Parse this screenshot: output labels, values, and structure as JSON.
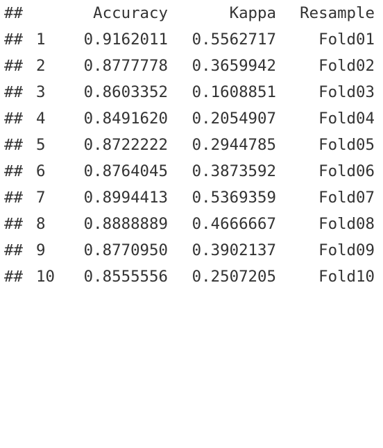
{
  "prompt": "##",
  "header": {
    "accuracy": "Accuracy",
    "kappa": "Kappa",
    "resample": "Resample"
  },
  "rows": [
    {
      "idx": "1",
      "accuracy": "0.9162011",
      "kappa": "0.5562717",
      "resample": "Fold01"
    },
    {
      "idx": "2",
      "accuracy": "0.8777778",
      "kappa": "0.3659942",
      "resample": "Fold02"
    },
    {
      "idx": "3",
      "accuracy": "0.8603352",
      "kappa": "0.1608851",
      "resample": "Fold03"
    },
    {
      "idx": "4",
      "accuracy": "0.8491620",
      "kappa": "0.2054907",
      "resample": "Fold04"
    },
    {
      "idx": "5",
      "accuracy": "0.8722222",
      "kappa": "0.2944785",
      "resample": "Fold05"
    },
    {
      "idx": "6",
      "accuracy": "0.8764045",
      "kappa": "0.3873592",
      "resample": "Fold06"
    },
    {
      "idx": "7",
      "accuracy": "0.8994413",
      "kappa": "0.5369359",
      "resample": "Fold07"
    },
    {
      "idx": "8",
      "accuracy": "0.8888889",
      "kappa": "0.4666667",
      "resample": "Fold08"
    },
    {
      "idx": "9",
      "accuracy": "0.8770950",
      "kappa": "0.3902137",
      "resample": "Fold09"
    },
    {
      "idx": "10",
      "accuracy": "0.8555556",
      "kappa": "0.2507205",
      "resample": "Fold10"
    }
  ]
}
